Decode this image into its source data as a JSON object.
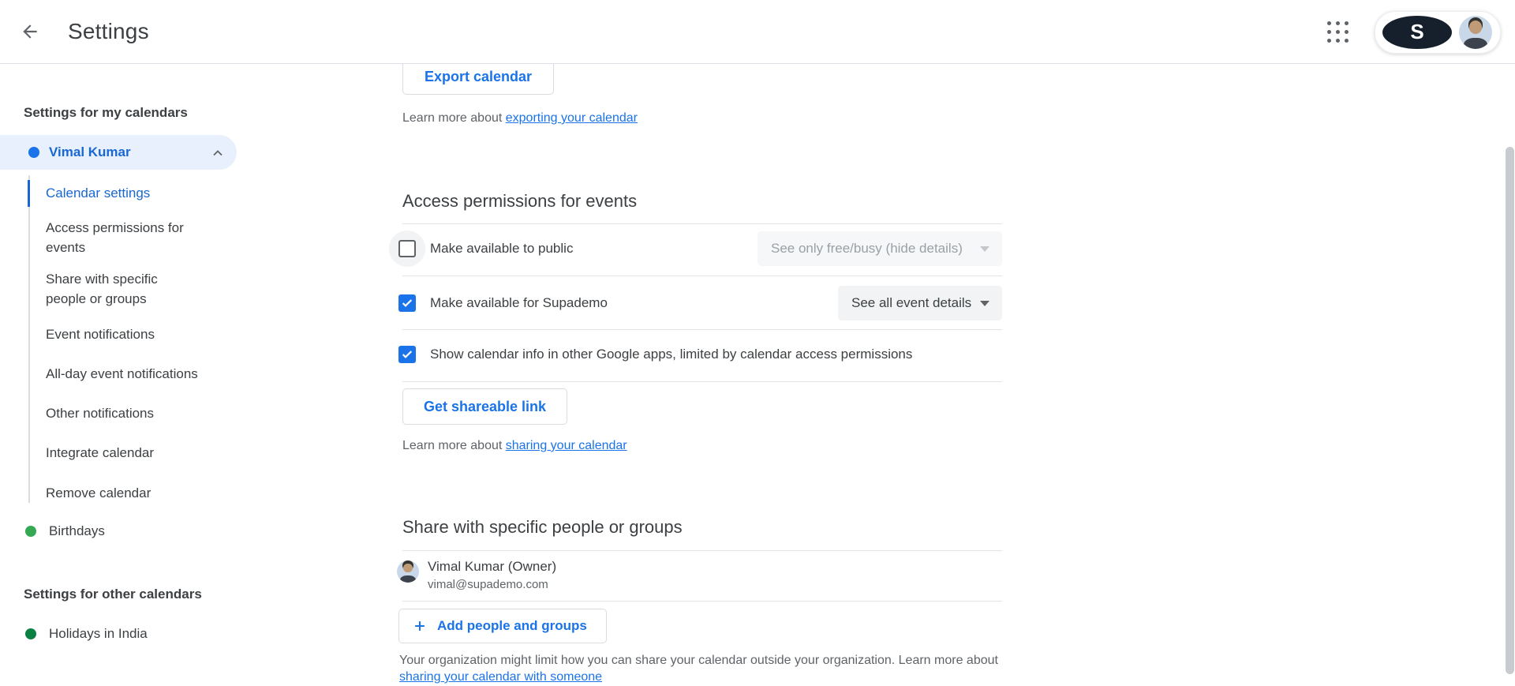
{
  "header": {
    "title": "Settings",
    "icons": {
      "back": "back-arrow-icon",
      "apps": "apps-grid-icon",
      "logo_letter": "S"
    }
  },
  "sidebar": {
    "my_calendars_heading": "Settings for my calendars",
    "selected_calendar": {
      "name": "Vimal Kumar",
      "dot_color": "#1a73e8",
      "expanded": true
    },
    "sub_items": [
      "Calendar settings",
      "Access permissions for events",
      "Share with specific people or groups",
      "Event notifications",
      "All-day event notifications",
      "Other notifications",
      "Integrate calendar",
      "Remove calendar"
    ],
    "active_sub_item": "Calendar settings",
    "birthdays_label": "Birthdays",
    "birthdays_dot_color": "#34a853",
    "other_calendars_heading": "Settings for other calendars",
    "other_calendar_label": "Holidays in India",
    "other_calendar_dot_color": "#0b8043"
  },
  "main": {
    "export": {
      "button": "Export calendar",
      "learn_prefix": "Learn more about ",
      "learn_link": "exporting your calendar"
    },
    "access": {
      "heading": "Access permissions for events",
      "rows": [
        {
          "label": "Make available to public",
          "checked": false,
          "select_value": "See only free/busy (hide details)",
          "select_disabled": true
        },
        {
          "label": "Make available for Supademo",
          "checked": true,
          "select_value": "See all event details",
          "select_disabled": false
        },
        {
          "label": "Show calendar info in other Google apps, limited by calendar access permissions",
          "checked": true
        }
      ],
      "shareable_button": "Get shareable link",
      "learn_prefix": "Learn more about ",
      "learn_link": "sharing your calendar"
    },
    "share": {
      "heading": "Share with specific people or groups",
      "owner": {
        "name": "Vimal Kumar (Owner)",
        "email": "vimal@supademo.com"
      },
      "add_button": "Add people and groups",
      "org_note": "Your organization might limit how you can share your calendar outside your organization. Learn more about",
      "org_note_link": "sharing your calendar with someone"
    }
  },
  "colors": {
    "accent_blue": "#1a73e8",
    "selected_blue": "#1967d2",
    "text_primary": "#3c4043",
    "text_secondary": "#5f6368",
    "divider": "#e2e4e7",
    "selected_pill_bg": "#e8f0fe"
  }
}
